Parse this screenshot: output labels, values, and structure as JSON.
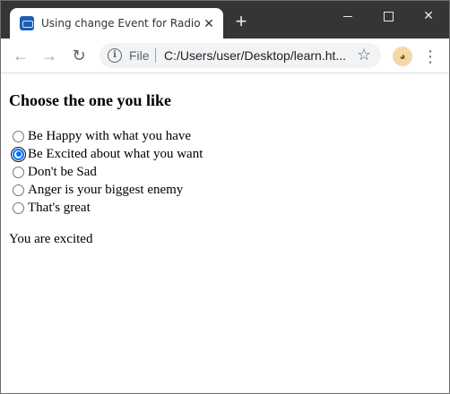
{
  "tab": {
    "title": "Using change Event for Radio Bu",
    "close": "✕"
  },
  "window_controls": {
    "new_tab": "+",
    "close": "✕"
  },
  "toolbar": {
    "back": "←",
    "forward": "→",
    "reload": "↻",
    "info": "i",
    "scheme": "File",
    "url": "C:/Users/user/Desktop/learn.ht...",
    "bookmark": "☆",
    "menu": "⋮"
  },
  "page": {
    "heading": "Choose the one you like",
    "options": [
      {
        "label": "Be Happy with what you have",
        "checked": false
      },
      {
        "label": "Be Excited about what you want",
        "checked": true
      },
      {
        "label": "Don't be Sad",
        "checked": false
      },
      {
        "label": "Anger is your biggest enemy",
        "checked": false
      },
      {
        "label": "That's great",
        "checked": false
      }
    ],
    "result": "You are excited"
  },
  "colors": {
    "accent": "#0075ff",
    "titlebar": "#353535"
  },
  "icons": {
    "favicon": "page-favicon",
    "info": "info-icon",
    "bookmark": "star-icon",
    "menu": "kebab-menu-icon"
  }
}
